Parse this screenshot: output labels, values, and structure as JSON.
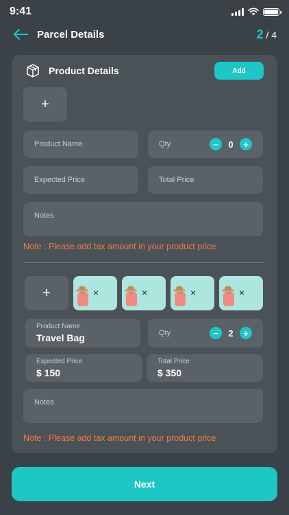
{
  "status_bar": {
    "time": "9:41"
  },
  "header": {
    "title": "Parcel Details",
    "page_current": "2",
    "page_total": "/ 4"
  },
  "section": {
    "title": "Product Details",
    "add_label": "Add"
  },
  "plus_glyph": "+",
  "minus_glyph": "−",
  "product_1": {
    "name_placeholder": "Product Name",
    "qty_label": "Qty",
    "qty_value": "0",
    "expected_price_placeholder": "Expected Price",
    "total_price_placeholder": "Total Price",
    "notes_placeholder": "Notes",
    "note_text": "Note :  Please add tax amount in your product price"
  },
  "product_2": {
    "images": [
      "travel-bag-image",
      "travel-bag-image",
      "travel-bag-image",
      "travel-bag-image"
    ],
    "remove_glyph": "×",
    "name_label": "Product Name",
    "name_value": "Travel Bag",
    "qty_label": "Qty",
    "qty_value": "2",
    "expected_price_label": "Expected Price",
    "expected_price_value": "$ 150",
    "total_price_label": "Total Price",
    "total_price_value": "$ 350",
    "notes_placeholder": "Notes",
    "note_text": "Note :  Please add tax amount in your product price"
  },
  "footer": {
    "next_label": "Next"
  },
  "colors": {
    "accent": "#1ec6c6",
    "note": "#f07a45",
    "background": "#3b4247",
    "card": "#4a5258",
    "field": "#5a6167"
  }
}
